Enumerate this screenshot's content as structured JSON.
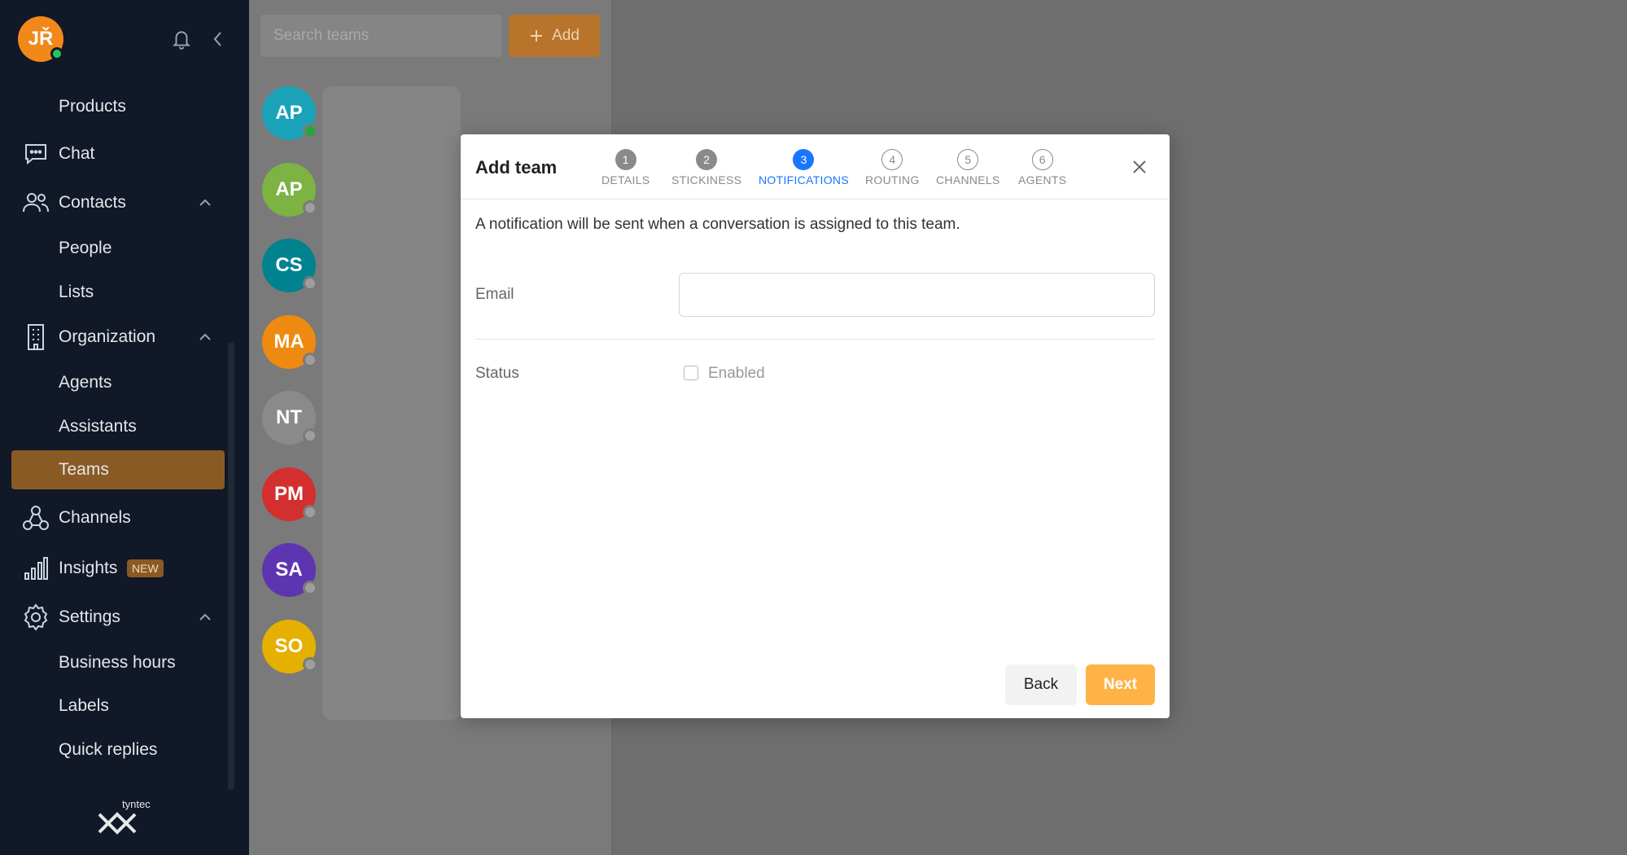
{
  "user": {
    "initials": "JŘ"
  },
  "sidebar": {
    "products": "Products",
    "chat": "Chat",
    "contacts": "Contacts",
    "people": "People",
    "lists": "Lists",
    "organization": "Organization",
    "agents": "Agents",
    "assistants": "Assistants",
    "teams": "Teams",
    "channels": "Channels",
    "insights": "Insights",
    "insights_badge": "NEW",
    "settings": "Settings",
    "business_hours": "Business hours",
    "labels": "Labels",
    "quick_replies": "Quick replies",
    "logo_text": "tyntec"
  },
  "teams_panel": {
    "search_placeholder": "Search teams",
    "add_label": "Add",
    "teams": [
      {
        "initials": "AP",
        "color": "#1aa3b8",
        "status": "#22a83a"
      },
      {
        "initials": "AP",
        "color": "#7cb342",
        "status": "#9e9e9e"
      },
      {
        "initials": "CS",
        "color": "#00838f",
        "status": "#9e9e9e"
      },
      {
        "initials": "MA",
        "color": "#ef8a10",
        "status": "#9e9e9e"
      },
      {
        "initials": "NT",
        "color": "#8a8a8a",
        "status": "#9e9e9e"
      },
      {
        "initials": "PM",
        "color": "#d32f2f",
        "status": "#9e9e9e"
      },
      {
        "initials": "SA",
        "color": "#5e35b1",
        "status": "#9e9e9e"
      },
      {
        "initials": "SO",
        "color": "#e5b000",
        "status": "#9e9e9e"
      }
    ]
  },
  "modal": {
    "title": "Add team",
    "steps": [
      {
        "num": "1",
        "label": "DETAILS"
      },
      {
        "num": "2",
        "label": "STICKINESS"
      },
      {
        "num": "3",
        "label": "NOTIFICATIONS"
      },
      {
        "num": "4",
        "label": "ROUTING"
      },
      {
        "num": "5",
        "label": "CHANNELS"
      },
      {
        "num": "6",
        "label": "AGENTS"
      }
    ],
    "description": "A notification will be sent when a conversation is assigned to this team.",
    "email_label": "Email",
    "email_value": "",
    "status_label": "Status",
    "enabled_label": "Enabled",
    "back_label": "Back",
    "next_label": "Next"
  },
  "colors": {
    "accent": "#ffb347",
    "step_active": "#1976ff",
    "sidebar_bg": "#111827",
    "active_nav": "#8a5a25"
  }
}
